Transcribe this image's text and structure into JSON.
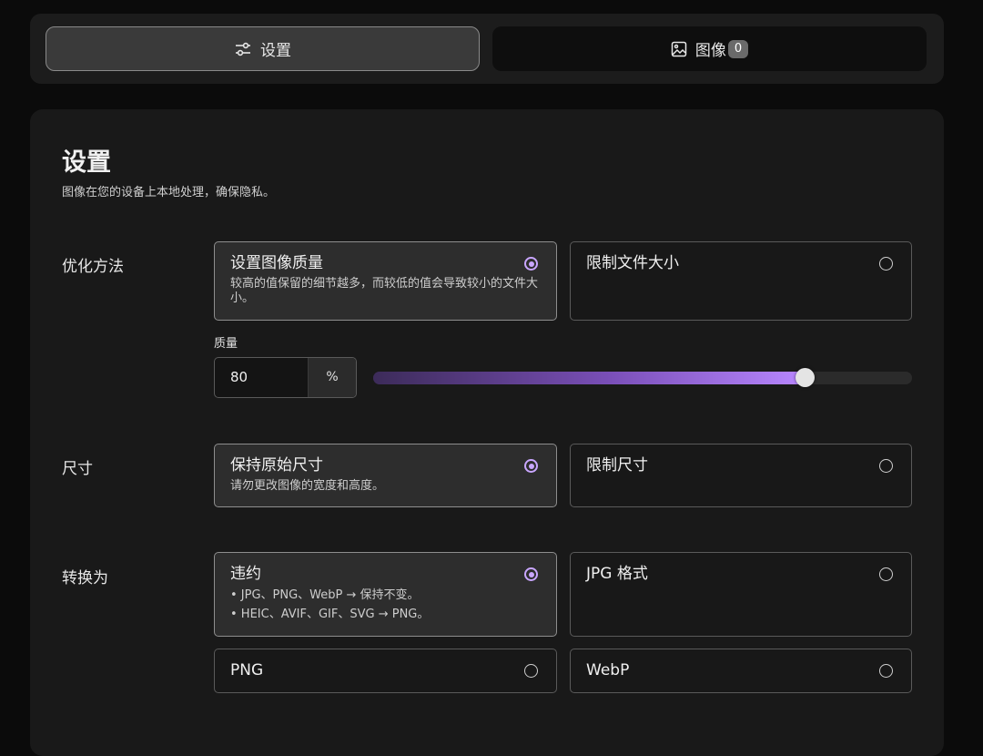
{
  "tabs": [
    {
      "label": "设置",
      "icon": "sliders-icon",
      "active": true
    },
    {
      "label": "图像",
      "icon": "image-icon",
      "badge": "0",
      "active": false
    }
  ],
  "settings": {
    "title": "设置",
    "subtitle": "图像在您的设备上本地处理，确保隐私。",
    "optimization": {
      "label": "优化方法",
      "options": [
        {
          "title": "设置图像质量",
          "desc": "较高的值保留的细节越多，而较低的值会导致较小的文件大小。",
          "selected": true
        },
        {
          "title": "限制文件大小",
          "selected": false
        }
      ],
      "quality": {
        "label": "质量",
        "value": "80",
        "unit": "%",
        "percent": 80
      }
    },
    "dimensions": {
      "label": "尺寸",
      "options": [
        {
          "title": "保持原始尺寸",
          "desc": "请勿更改图像的宽度和高度。",
          "selected": true
        },
        {
          "title": "限制尺寸",
          "selected": false
        }
      ]
    },
    "convert": {
      "label": "转换为",
      "options": [
        {
          "title": "违约",
          "lines": [
            "• JPG、PNG、WebP → 保持不变。",
            "• HEIC、AVIF、GIF、SVG → PNG。"
          ],
          "selected": true
        },
        {
          "title": "JPG 格式",
          "selected": false
        },
        {
          "title": "PNG",
          "selected": false
        },
        {
          "title": "WebP",
          "selected": false
        }
      ]
    }
  },
  "colors": {
    "accent": "#c9a6ff",
    "background": "#0b0b0b",
    "panel": "#191919"
  }
}
